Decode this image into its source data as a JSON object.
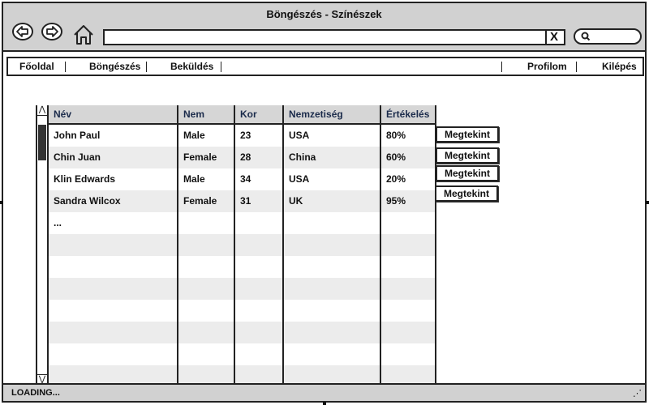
{
  "window": {
    "title": "Böngészés - Színészek"
  },
  "toolbar": {
    "back_icon": "arrow-left-icon",
    "forward_icon": "arrow-right-icon",
    "home_icon": "home-icon",
    "url_value": "",
    "clear_label": "X",
    "search_icon": "search-icon"
  },
  "menu": {
    "left": [
      "Főoldal",
      "Böngészés",
      "Beküldés"
    ],
    "right": [
      "Profilom",
      "Kilépés"
    ]
  },
  "table": {
    "columns": [
      "Név",
      "Nem",
      "Kor",
      "Nemzetiség",
      "Értékelés"
    ],
    "rows": [
      [
        "John Paul",
        "Male",
        "23",
        "USA",
        "80%"
      ],
      [
        "Chin Juan",
        "Female",
        "28",
        "China",
        "60%"
      ],
      [
        "Klin Edwards",
        "Male",
        "34",
        "USA",
        "20%"
      ],
      [
        "Sandra Wilcox",
        "Female",
        "31",
        "UK",
        "95%"
      ],
      [
        "...",
        "",
        "",
        "",
        ""
      ]
    ],
    "action_label": "Megtekint"
  },
  "status": {
    "text": "LOADING..."
  }
}
